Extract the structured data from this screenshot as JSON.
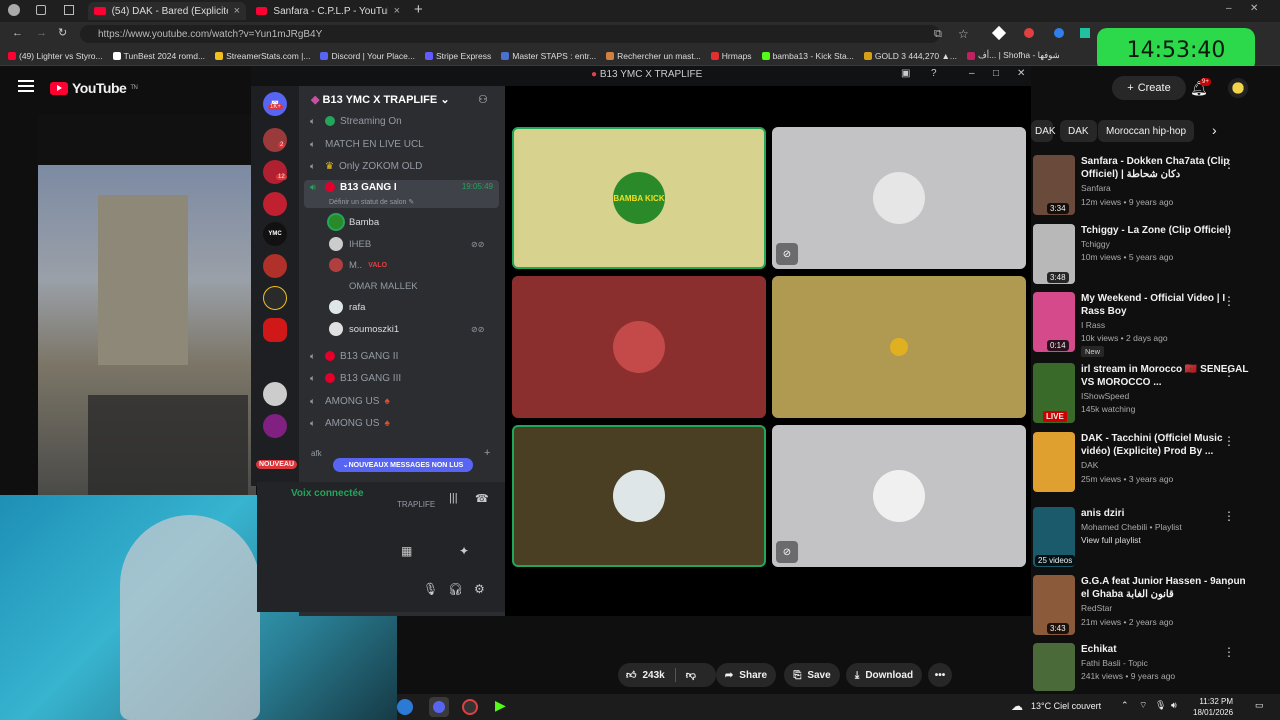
{
  "browser": {
    "tabs": [
      {
        "label": "(54) DAK - Bared (Explicite) - You"
      },
      {
        "label": "Sanfara - C.P.L.P - YouTube"
      }
    ],
    "url": "https://www.youtube.com/watch?v=Yun1mJRgB4Y",
    "bookmarks": [
      "(49) Lighter vs Styro...",
      "TunBest 2024 romd...",
      "StreamerStats.com |...",
      "Discord | Your Place...",
      "Stripe Express",
      "Master STAPS : entr...",
      "Rechercher un mast...",
      "Hrmaps",
      "bamba13 - Kick Sta...",
      "GOLD 3 444,270 ▲...",
      "أف... | Shofha - شوفها"
    ]
  },
  "clock_overlay": "14:53:40",
  "youtube": {
    "brand": "YouTube",
    "country_code": "TN",
    "create_label": "Create",
    "notif_count": "9+",
    "chips": [
      "DAK",
      "DAK",
      "Moroccan hip-hop"
    ],
    "actions": {
      "likes": "243k",
      "share": "Share",
      "save": "Save",
      "download": "Download"
    },
    "recommendations": [
      {
        "title": "Sanfara - Dokken Cha7ata (Clip Officiel) | دكان شحاطة",
        "channel": "Sanfara",
        "meta": "12m views • 9 years ago",
        "duration": "3:34",
        "color": "#6a4a3a"
      },
      {
        "title": "Tchiggy - La Zone (Clip Officiel)",
        "channel": "Tchiggy",
        "meta": "10m views • 5 years ago",
        "duration": "3:48",
        "color": "#b8b8b8"
      },
      {
        "title": "My Weekend - Official Video | I Rass Boy",
        "channel": "I Rass",
        "meta": "10k views • 2 days ago",
        "duration": "0:14",
        "badge": "New",
        "color": "#d44a8a"
      },
      {
        "title": "irl stream in Morocco 🇲🇦 SENEGAL VS MOROCCO ...",
        "channel": "IShowSpeed",
        "meta": "145k watching",
        "live": "LIVE",
        "color": "#3a6a2a"
      },
      {
        "title": "DAK - Tacchini (Officiel Music vidéo) (Explicite) Prod By ...",
        "channel": "DAK",
        "meta": "25m views • 3 years ago",
        "color": "#e0a030"
      },
      {
        "title": "anis dziri",
        "channel": "Mohamed Chebili • Playlist",
        "meta": "View full playlist",
        "duration": "25 videos",
        "color": "#1a5a6a"
      },
      {
        "title": "G.G.A feat Junior Hassen - 9anoun el Ghaba قانون الغابة",
        "channel": "RedStar",
        "meta": "21m views • 2 years ago",
        "duration": "3:43",
        "color": "#8a5a3a"
      },
      {
        "title": "Echikat",
        "channel": "Fathi Basli - Topic",
        "meta": "241k views • 9 years ago",
        "color": "#4a6a3a"
      }
    ]
  },
  "discord": {
    "window_title": "B13 YMC X TRAPLIFE",
    "server_name": "B13 YMC X TRAPLIFE",
    "guild_badges": [
      "1K+",
      "12",
      "2"
    ],
    "guild_labels": [
      "YMC",
      "NOUVEAU"
    ],
    "channels_top": [
      {
        "name": "Streaming On",
        "marker": "green"
      },
      {
        "name": "MATCH EN LIVE UCL"
      },
      {
        "name": "Only ZOKOM OLD",
        "marker": "crown"
      }
    ],
    "active_channel": {
      "name": "B13 GANG I",
      "timer": "19:05:49",
      "status": "Définir un statut de salon"
    },
    "members": [
      {
        "name": "Bamba"
      },
      {
        "name": "IHEB"
      },
      {
        "name": "M..",
        "tag": "VALO"
      },
      {
        "name": "OMAR MALLEK"
      },
      {
        "name": "rafa"
      },
      {
        "name": "soumoszki1"
      }
    ],
    "channels_bottom": [
      {
        "name": "B13 GANG II",
        "marker": "red"
      },
      {
        "name": "B13 GANG III",
        "marker": "red"
      },
      {
        "name": "AMONG US"
      },
      {
        "name": "AMONG US"
      }
    ],
    "category": "afk",
    "unread_label": "NOUVEAUX MESSAGES NON LUS",
    "voice_status": "Voix connectée",
    "voice_channel_short": "TRAPLIFE",
    "tiles": [
      {
        "bg": "#d7d28e",
        "avatar": "#2a8a2a",
        "label": "BAMBA KICK",
        "speaking": true
      },
      {
        "bg": "#c3c3c6",
        "avatar": "#e6e6e6",
        "muted": true
      },
      {
        "bg": "#8a2e2e",
        "avatar": "#c44a4a"
      },
      {
        "bg": "#b09a52",
        "avatar": "#e0b020"
      },
      {
        "bg": "#4a3f22",
        "avatar": "#dfe6e8",
        "speaking": true
      },
      {
        "bg": "#c3c3c6",
        "avatar": "#f0f0f0",
        "muted": true
      }
    ]
  },
  "taskbar": {
    "weather": "13°C  Ciel couvert",
    "time": "11:32 PM",
    "date": "18/01/2026"
  }
}
